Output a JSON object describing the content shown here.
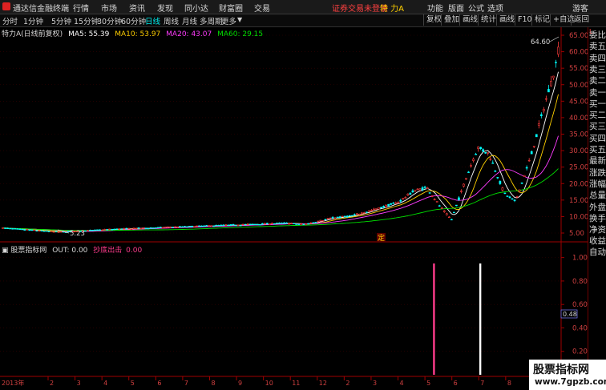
{
  "menubar": {
    "app_title": "通达信金融终端",
    "menus": [
      "行情",
      "市场",
      "资讯",
      "发现",
      "同小达",
      "财富圈",
      "交易"
    ],
    "login_status": "证券交易未登录",
    "stock_name": "特 力A",
    "right_menus": [
      "功能",
      "版面",
      "公式",
      "选项"
    ],
    "guest": "游客"
  },
  "toolbar": {
    "periods": [
      "分时",
      "1分钟",
      "5分钟",
      "15分钟",
      "30分钟",
      "60分钟",
      "日线",
      "周线",
      "月线",
      "多周期",
      "更多"
    ],
    "active_period": "日线",
    "right_buttons": [
      "复权",
      "叠加",
      "画线",
      "统计",
      "画线",
      "F10",
      "标记",
      "+自选",
      "返回"
    ]
  },
  "price_panel": {
    "title": "特力A(日线前复权)",
    "ma": [
      {
        "label": "MA5: 55.39",
        "color": "#ffffff"
      },
      {
        "label": "MA10: 53.97",
        "color": "#ffd000"
      },
      {
        "label": "MA20: 43.07",
        "color": "#ff3cff"
      },
      {
        "label": "MA60: 29.15",
        "color": "#00e000"
      }
    ],
    "high_label": "64.60",
    "low_label": "5.23",
    "marker_label": "定",
    "y_axis": [
      "65.00",
      "60.00",
      "55.00",
      "50.00",
      "45.00",
      "40.00",
      "35.00",
      "30.00",
      "25.00",
      "20.00",
      "15.00",
      "10.00",
      "5.00"
    ],
    "y_min": 5,
    "y_max": 65
  },
  "indicator_panel": {
    "title": "股票指标网",
    "out_label": "OUT: 0.00",
    "signal_label": "抄底出击",
    "signal_value": "0.00",
    "y_axis": [
      "1.00",
      "0.80",
      "0.60",
      "0.40",
      "0.20"
    ],
    "current_value": "0.48"
  },
  "x_axis": {
    "year_label": "2013年",
    "months": [
      "2",
      "3",
      "4",
      "5",
      "6",
      "7",
      "8",
      "9",
      "10",
      "11",
      "12",
      "2",
      "3",
      "4",
      "5",
      "6",
      "7",
      "8",
      "9"
    ]
  },
  "right_panel": {
    "tag": "L",
    "items": [
      "委比",
      "卖五",
      "卖四",
      "卖三",
      "卖二",
      "卖一",
      "买一",
      "买二",
      "买三",
      "买四",
      "买五",
      "最新",
      "涨跌",
      "涨幅",
      "总量",
      "外盘",
      "换手",
      "净资",
      "收益"
    ],
    "auto_label": "自动"
  },
  "watermark": {
    "line1": "股票指标网",
    "line2": "www.7gpzb.com"
  },
  "chart_data": {
    "type": "candlestick",
    "price_range": [
      5,
      65
    ],
    "ma_series": [
      "MA5",
      "MA10",
      "MA20",
      "MA60"
    ],
    "indicator_signals": [
      {
        "color": "#ff3c8c",
        "value": 1.0
      },
      {
        "color": "#ffffff",
        "value": 1.0
      }
    ],
    "indicator_range": [
      0,
      1.1
    ]
  },
  "colors": {
    "up": "#ff3c3c",
    "down": "#00ffff",
    "axis": "#a00000",
    "grid": "#500000",
    "accent": "#ff2020"
  }
}
